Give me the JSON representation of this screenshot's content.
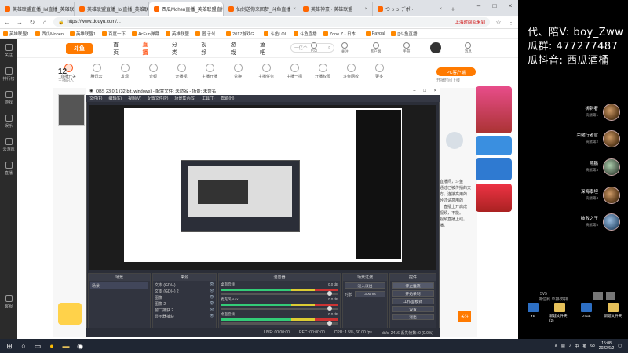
{
  "browser": {
    "tabs": [
      {
        "label": "英雄联盟直播_lol直播_英雄联盟..."
      },
      {
        "label": "英雄联盟直播_lol直播_英雄联盟"
      },
      {
        "label": "西瓜Mohen直播_英雄联盟直播..."
      },
      {
        "label": "仙剑送你来回梦_斗鱼直播"
      },
      {
        "label": "英雄神豪 ⋅ 英雄联盟"
      },
      {
        "label": "つっっ デポ···"
      }
    ],
    "active_tab_index": 2,
    "url": "https://www.douyu.com/...",
    "url_right_text": "上海时间回来到",
    "bookmarks": [
      "英雄联盟1",
      "西瓜Mohen",
      "英雄联盟1",
      "百度一下",
      "AcFun弹幕",
      "英雄联盟",
      "图 공식 ...",
      "2017游戏G...",
      "斗鱼LOL",
      "斗鱼直播",
      "Zone Z - 日本...",
      "Paypal",
      "[]斗鱼直播"
    ]
  },
  "douyu": {
    "logo_text": "斗鱼",
    "nav": [
      "首页",
      "直播",
      "分类",
      "视频",
      "游戏",
      "鱼吧"
    ],
    "search_placeholder": "一亿个...",
    "header_icons": [
      "历史",
      "关注",
      "客户端",
      "手游",
      "开播",
      "消息"
    ],
    "count": "12",
    "count_label": "主播的人",
    "categories": [
      "直播开关",
      "腾讯云",
      "发现",
      "音频",
      "开播视",
      "主播开播",
      "兑换",
      "主播任务",
      "主播一招",
      "开播权限",
      "斗鱼网校",
      "更多"
    ],
    "pc_button": "PC客户端",
    "pc_sub": "开播时间上线",
    "leftbar": [
      "关注",
      "排行榜",
      "游戏",
      "娱乐",
      "云游戏",
      "直播",
      "客服"
    ],
    "right_text": [
      "直播间，斗鱼",
      "通过已被传播的文",
      "方，连接高用的",
      "经过请高用的",
      "一直播上开启成",
      "视频，不能。",
      "视频直播上线。",
      "播。"
    ],
    "follow_label": "关注"
  },
  "obs": {
    "title": "OBS 23.0.1 (32-bit, windows) - 配置文件: 未命名 - 场景: 未命名",
    "menu": [
      "文件(F)",
      "编辑(E)",
      "视图(V)",
      "配置文件(P)",
      "场景集合(S)",
      "工具(T)",
      "帮助(H)"
    ],
    "docks": {
      "scenes": {
        "title": "场景",
        "items": [
          "场景"
        ]
      },
      "sources": {
        "title": "来源",
        "items": [
          "文本 (GDI+)",
          "文本 (GDI+) 2",
          "图像",
          "图像 2",
          "窗口捕获 2",
          "显示器捕获"
        ]
      },
      "mixer": {
        "title": "混音器",
        "items": [
          {
            "name": "桌面音频",
            "db": "0.0 dB"
          },
          {
            "name": "麦克风/Aux",
            "db": "0.0 dB"
          },
          {
            "name": "桌面音频",
            "db": "0.0 dB"
          }
        ]
      },
      "transitions": {
        "title": "场景过渡",
        "mode": "淡入淡出",
        "duration_label": "时长",
        "duration": "300ms"
      },
      "controls": {
        "title": "控件",
        "buttons": [
          "停止推流",
          "开始录制",
          "工作室模式",
          "设置",
          "退出"
        ]
      }
    },
    "status": {
      "live": "LIVE: 00:00:00",
      "rec": "REC: 00:00:00",
      "cpu": "CPU: 1.5%, 60.00 fps",
      "kbps": "kb/s: 2416 丢失帧数: 0 (0.0%)"
    }
  },
  "overlay": {
    "lines": [
      "代、陪V: boy_Zww",
      "瓜群: 477277487",
      "瓜抖音: 西瓜酒桶"
    ],
    "leaders": [
      {
        "name": "狮刺者",
        "sub": "贡献第1"
      },
      {
        "name": "荣耀行者官",
        "sub": "贡献第2"
      },
      {
        "name": "燕鹏",
        "sub": "贡献第3"
      },
      {
        "name": "深海泰坦",
        "sub": "贡献第4"
      },
      {
        "name": "破败之王",
        "sub": "贡献第5"
      }
    ],
    "bottom_label": "5V5",
    "bottom_label2": "排位赛 单排/双排"
  },
  "desktop": {
    "icons": [
      {
        "label": "YB"
      },
      {
        "label": "新建文件夹 (2)"
      },
      {
        "label": "JTGL"
      },
      {
        "label": "新建文件夹"
      }
    ]
  },
  "taskbar": {
    "time": "15:08",
    "date": "2022/6/2",
    "tray": [
      "∧",
      "中",
      "英",
      "68"
    ]
  },
  "colors": {
    "douyu_orange": "#ff7a00",
    "obs_bg": "#2b2e38"
  }
}
